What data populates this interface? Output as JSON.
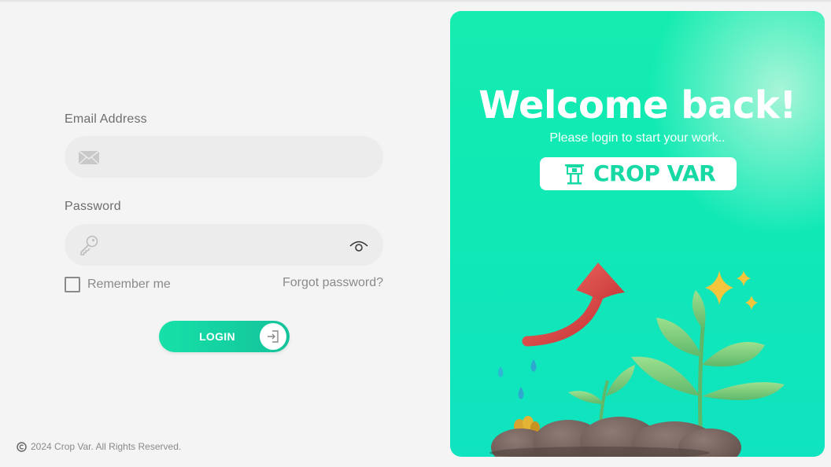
{
  "form": {
    "email_label": "Email Address",
    "email_value": "",
    "password_label": "Password",
    "password_value": "",
    "remember_label": "Remember me",
    "remember_checked": false,
    "forgot_label": "Forgot password?",
    "login_label": "LOGIN"
  },
  "footer": {
    "text": "2024 Crop Var. All Rights Reserved."
  },
  "panel": {
    "title": "Welcome back!",
    "subtitle": "Please login to start your work..",
    "brand": "CROP VAR"
  },
  "icons": {
    "email": "envelope-icon",
    "password": "key-icon",
    "show_password": "eye-icon",
    "login": "login-arrow-icon",
    "copyright": "copyright-icon",
    "brand_logo": "billboard-icon"
  },
  "colors": {
    "accent": "#16e0a8",
    "panel": "#10e8b6",
    "page_bg": "#f4f4f4",
    "field_bg": "#ececec"
  }
}
